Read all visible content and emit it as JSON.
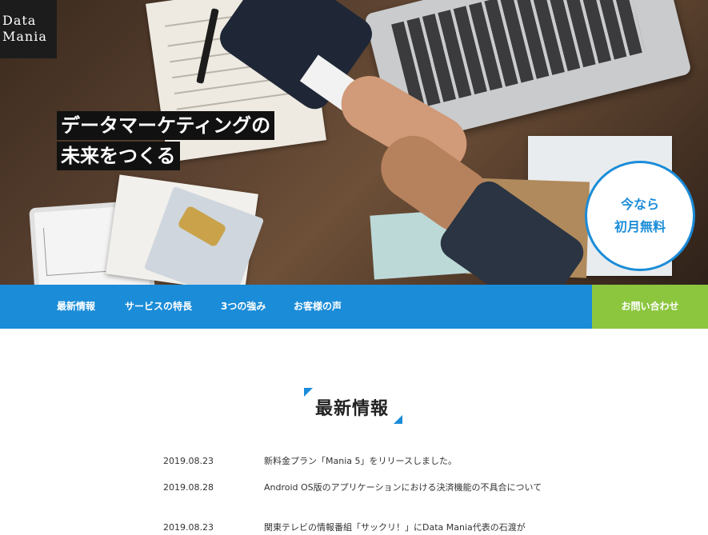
{
  "brand": {
    "logo_line1": "Data",
    "logo_line2": "Mania"
  },
  "hero": {
    "headline_line1": "データマーケティングの",
    "headline_line2": "未来をつくる",
    "badge_line1": "今なら",
    "badge_line2": "初月無料"
  },
  "nav": {
    "items": [
      {
        "label": "最新情報"
      },
      {
        "label": "サービスの特長"
      },
      {
        "label": "3つの強み"
      },
      {
        "label": "お客様の声"
      }
    ],
    "contact_label": "お問い合わせ"
  },
  "news": {
    "heading": "最新情報",
    "items": [
      {
        "date": "2019.08.23",
        "title": "新料金プラン「Mania 5」をリリースしました。"
      },
      {
        "date": "2019.08.28",
        "title": "Android OS版のアプリケーションにおける決済機能の不具合について"
      },
      {
        "date": "2019.08.23",
        "title": "関東テレビの情報番組「サックリ！」にData Mania代表の石渡が"
      }
    ]
  },
  "colors": {
    "accent_blue": "#1a8cd8",
    "accent_green": "#8cc63f",
    "logo_bg": "#1c1c1c"
  }
}
